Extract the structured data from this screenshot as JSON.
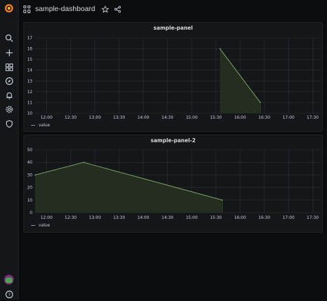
{
  "navbar": {
    "title": "sample-dashboard"
  },
  "sidemenu": {
    "items": [
      "grafana-logo-icon",
      "search-icon",
      "plus-icon",
      "dashboards-icon",
      "explore-icon",
      "alerting-icon",
      "gear-icon",
      "shield-icon"
    ]
  },
  "colors": {
    "series": "#7eb26d",
    "fill": "#26301f",
    "grid": "#2c3235",
    "background": "#0b0c0e",
    "panel": "#141619"
  },
  "chart_data": [
    {
      "type": "area",
      "title": "sample-panel",
      "x": [
        "15:35",
        "16:25"
      ],
      "series": [
        {
          "name": "value",
          "values": [
            16,
            11
          ]
        }
      ],
      "ylim": [
        10,
        17
      ],
      "yticks": [
        "10",
        "11",
        "12",
        "13",
        "14",
        "15",
        "16",
        "17"
      ],
      "xtick_labels": [
        "12:00",
        "12:30",
        "13:00",
        "13:30",
        "14:00",
        "14:30",
        "15:00",
        "15:30",
        "16:00",
        "16:30",
        "17:00",
        "17:30"
      ],
      "xlim": [
        "11:46",
        "17:40"
      ],
      "grid": true,
      "legend": "bottom-left"
    },
    {
      "type": "area",
      "title": "sample-panel-2",
      "x": [
        "11:46",
        "12:46",
        "15:38"
      ],
      "series": [
        {
          "name": "value",
          "values": [
            30,
            40,
            10
          ]
        }
      ],
      "ylim": [
        0,
        50
      ],
      "yticks": [
        "0",
        "10",
        "20",
        "30",
        "40",
        "50"
      ],
      "xtick_labels": [
        "12:00",
        "12:30",
        "13:00",
        "13:30",
        "14:00",
        "14:30",
        "15:00",
        "15:30",
        "16:00",
        "16:30",
        "17:00",
        "17:30"
      ],
      "xlim": [
        "11:46",
        "17:40"
      ],
      "grid": true,
      "legend": "bottom-left"
    }
  ]
}
